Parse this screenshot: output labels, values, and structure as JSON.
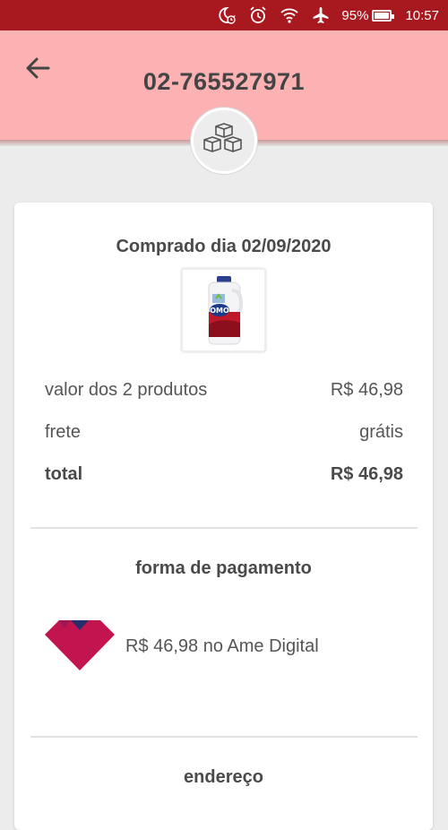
{
  "status_bar": {
    "battery_percent": "95%",
    "battery_level": 0.95,
    "time": "10:57",
    "icons": [
      "moon-clock-icon",
      "alarm-icon",
      "wifi-icon",
      "airplane-icon",
      "battery-icon"
    ]
  },
  "header": {
    "back_icon": "arrow-left-icon",
    "order_number": "02-765527971",
    "badge_icon": "boxes-icon"
  },
  "order": {
    "purchase_date": "Comprado dia 02/09/2020",
    "product_image_icon": "detergent-bottle-image",
    "summary": [
      {
        "label": "valor dos 2 produtos",
        "value": "R$ 46,98",
        "bold": false
      },
      {
        "label": "frete",
        "value": "grátis",
        "bold": false
      },
      {
        "label": "total",
        "value": "R$ 46,98",
        "bold": true
      }
    ]
  },
  "payment": {
    "title": "forma de pagamento",
    "logo_icon": "ame-digital-logo",
    "text": "R$ 46,98 no Ame Digital"
  },
  "address": {
    "title": "endereço"
  },
  "colors": {
    "status_bar": "#a8191f",
    "header_bg": "#fcb2b2",
    "ame_magenta": "#c2154f",
    "ame_navy": "#2a2d6b"
  }
}
